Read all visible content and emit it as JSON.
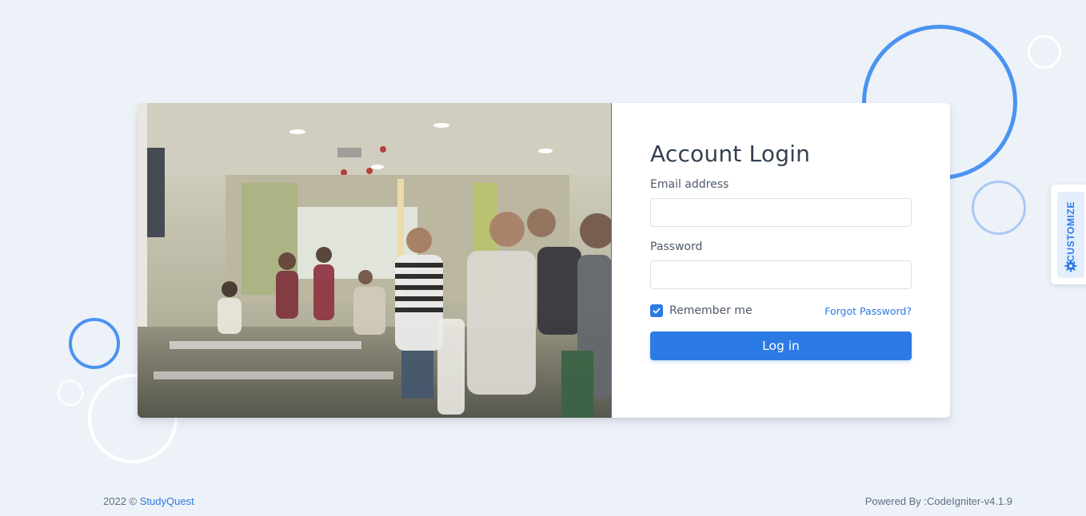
{
  "login": {
    "title": "Account Login",
    "email_label": "Email address",
    "email_value": "",
    "password_label": "Password",
    "password_value": "",
    "remember_label": "Remember me",
    "remember_checked": true,
    "forgot_label": "Forgot Password?",
    "submit_label": "Log in"
  },
  "customize": {
    "label": "CUSTOMIZE",
    "icon": "gear-icon"
  },
  "footer": {
    "year_text": "2022 ©",
    "brand": "StudyQuest",
    "powered": "Powered By :CodeIgniter-v4.1.9"
  },
  "colors": {
    "accent": "#2c7be5",
    "background": "#edf2f9",
    "text_dark": "#344050"
  }
}
